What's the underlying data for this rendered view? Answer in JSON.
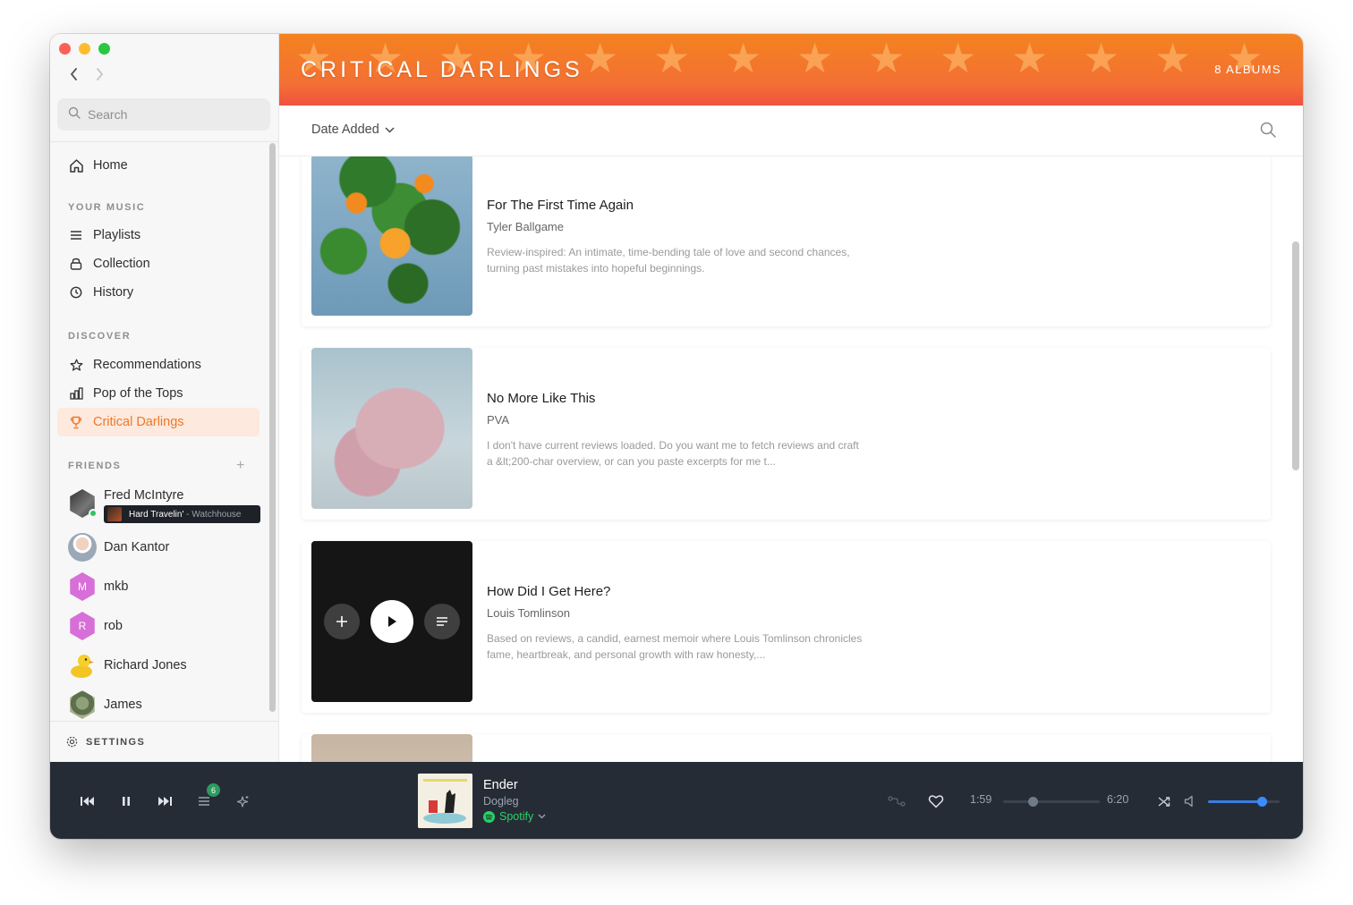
{
  "sidebar": {
    "search_placeholder": "Search",
    "home_label": "Home",
    "your_music_label": "YOUR MUSIC",
    "your_music_items": [
      {
        "label": "Playlists",
        "icon": "list-icon"
      },
      {
        "label": "Collection",
        "icon": "collection-icon"
      },
      {
        "label": "History",
        "icon": "clock-icon"
      }
    ],
    "discover_label": "DISCOVER",
    "discover_items": [
      {
        "label": "Recommendations",
        "icon": "star-icon"
      },
      {
        "label": "Pop of the Tops",
        "icon": "chart-icon"
      },
      {
        "label": "Critical Darlings",
        "icon": "trophy-icon",
        "active": true
      }
    ],
    "friends_label": "FRIENDS",
    "friends": [
      {
        "name": "Fred McIntyre",
        "online": true,
        "now_playing": {
          "track": "Hard Travelin'",
          "separator": " - ",
          "artist": "Watchhouse"
        }
      },
      {
        "name": "Dan Kantor"
      },
      {
        "name": "mkb",
        "initial": "M",
        "color": "#d86fd8"
      },
      {
        "name": "rob",
        "initial": "R",
        "color": "#d86fd8"
      },
      {
        "name": "Richard Jones"
      },
      {
        "name": "James"
      }
    ],
    "settings_label": "SETTINGS"
  },
  "header": {
    "title": "CRITICAL DARLINGS",
    "count": "8 ALBUMS"
  },
  "toolbar": {
    "sort_label": "Date Added"
  },
  "albums": [
    {
      "title": "For The First Time Again",
      "artist": "Tyler Ballgame",
      "description": "Review-inspired: An intimate, time-bending tale of love and second chances, turning past mistakes into hopeful beginnings."
    },
    {
      "title": "No More Like This",
      "artist": "PVA",
      "description": "I don't have current reviews loaded. Do you want me to fetch reviews and craft a &lt;200-char overview, or can you paste excerpts for me t..."
    },
    {
      "title": "How Did I Get Here?",
      "artist": "Louis Tomlinson",
      "description": "Based on reviews, a candid, earnest memoir where Louis Tomlinson chronicles fame, heartbreak, and personal growth with raw honesty,..."
    }
  ],
  "player": {
    "queue_count": "6",
    "track_title": "Ender",
    "track_artist": "Dogleg",
    "source": "Spotify",
    "elapsed": "1:59",
    "duration": "6:20",
    "progress_fraction": 0.31,
    "volume_fraction": 0.75
  },
  "colors": {
    "accent": "#f0772a",
    "header_gradient_top": "#f5821f",
    "header_gradient_bottom": "#f0523f",
    "player_bg": "#262c36",
    "spotify_green": "#25d366",
    "volume_blue": "#3a8bff"
  }
}
